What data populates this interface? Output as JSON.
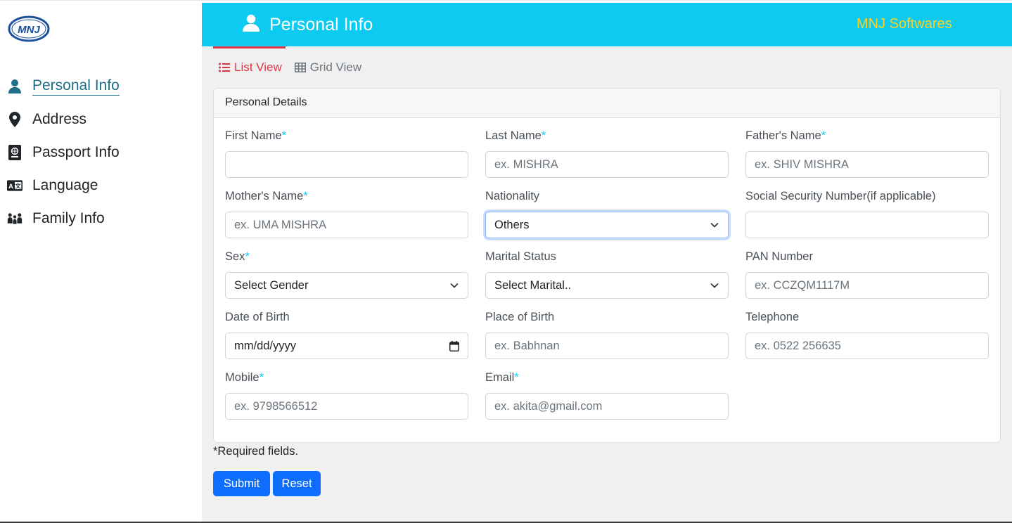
{
  "sidebar": {
    "logo_text": "MNJ",
    "items": [
      {
        "label": "Personal Info",
        "icon": "user-icon",
        "active": true
      },
      {
        "label": "Address",
        "icon": "map-pin-icon",
        "active": false
      },
      {
        "label": "Passport Info",
        "icon": "passport-icon",
        "active": false
      },
      {
        "label": "Language",
        "icon": "language-icon",
        "active": false
      },
      {
        "label": "Family Info",
        "icon": "people-icon",
        "active": false
      }
    ]
  },
  "header": {
    "title": "Personal Info",
    "brand": "MNJ Softwares",
    "bg_color": "#0dcaf0",
    "brand_color": "#ffd21f"
  },
  "tabs": {
    "list_view": "List View",
    "grid_view": "Grid View"
  },
  "card": {
    "title": "Personal Details"
  },
  "fields": {
    "first_name": {
      "label": "First Name",
      "required": "*",
      "placeholder": ""
    },
    "last_name": {
      "label": "Last Name",
      "required": "*",
      "placeholder": "ex. MISHRA"
    },
    "fathers_name": {
      "label": "Father's Name",
      "required": "*",
      "placeholder": "ex. SHIV MISHRA"
    },
    "mothers_name": {
      "label": "Mother's Name",
      "required": "*",
      "placeholder": "ex. UMA MISHRA"
    },
    "nationality": {
      "label": "Nationality",
      "value": "Others"
    },
    "ssn": {
      "label": "Social Security Number(if applicable)",
      "placeholder": ""
    },
    "sex": {
      "label": "Sex",
      "required": "*",
      "value": "Select Gender"
    },
    "marital_status": {
      "label": "Marital Status",
      "value": "Select Marital.."
    },
    "pan": {
      "label": "PAN Number",
      "placeholder": "ex. CCZQM1117M"
    },
    "dob": {
      "label": "Date of Birth",
      "value": "mm/dd/yyyy"
    },
    "pob": {
      "label": "Place of Birth",
      "placeholder": "ex. Babhnan"
    },
    "telephone": {
      "label": "Telephone",
      "placeholder": "ex. 0522 256635"
    },
    "mobile": {
      "label": "Mobile",
      "required": "*",
      "placeholder": "ex. 9798566512"
    },
    "email": {
      "label": "Email",
      "required": "*",
      "placeholder": "ex. akita@gmail.com"
    }
  },
  "footer": {
    "required_note": "*Required fields.",
    "submit": "Submit",
    "reset": "Reset"
  }
}
